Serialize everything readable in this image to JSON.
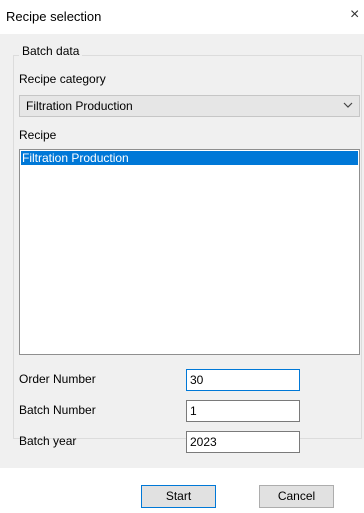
{
  "window": {
    "title": "Recipe selection",
    "close_glyph": "×"
  },
  "group": {
    "legend": "Batch data"
  },
  "category": {
    "label": "Recipe category",
    "selected": "Filtration Production",
    "arrow_icon": "chevron-down-icon"
  },
  "recipe": {
    "label": "Recipe",
    "items": [
      "Filtration Production"
    ],
    "selected_index": 0
  },
  "fields": {
    "order_number": {
      "label": "Order Number",
      "value": "30"
    },
    "batch_number": {
      "label": "Batch Number",
      "value": "1"
    },
    "batch_year": {
      "label": "Batch year",
      "value": "2023"
    }
  },
  "buttons": {
    "start": "Start",
    "cancel": "Cancel"
  },
  "colors": {
    "selection": "#0078d7",
    "panel": "#f0f0f0"
  }
}
